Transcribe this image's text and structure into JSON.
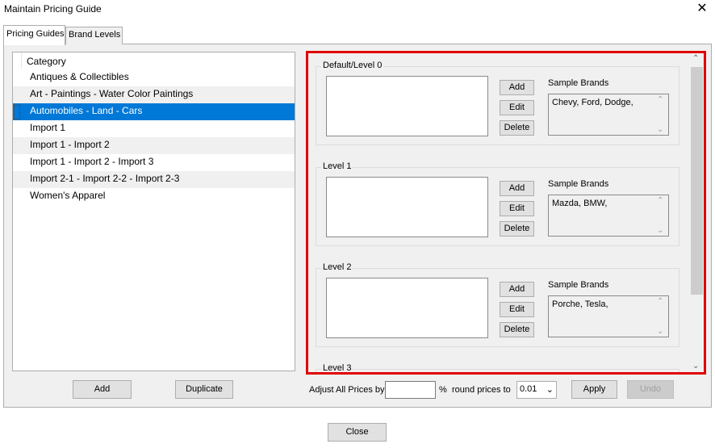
{
  "window": {
    "title": "Maintain Pricing Guide",
    "close_glyph": "✕"
  },
  "tabs": [
    {
      "label": "Pricing Guides",
      "active": true
    },
    {
      "label": "Brand Levels",
      "active": false
    }
  ],
  "category_list": {
    "header": "Category",
    "items": [
      "Antiques & Collectibles",
      "Art - Paintings - Water Color Paintings",
      "Automobiles - Land - Cars",
      "Import 1",
      "Import 1 - Import 2",
      "Import 1 - Import 2 - Import 3",
      "Import 2-1 - Import 2-2 - Import 2-3",
      "Women's Apparel"
    ],
    "selected_index": 2
  },
  "left_buttons": {
    "add": "Add",
    "duplicate": "Duplicate"
  },
  "levels": [
    {
      "label": "Default/Level 0",
      "add": "Add",
      "edit": "Edit",
      "delete": "Delete",
      "sample_label": "Sample Brands",
      "sample_brands": "Chevy, Ford, Dodge,"
    },
    {
      "label": "Level 1",
      "add": "Add",
      "edit": "Edit",
      "delete": "Delete",
      "sample_label": "Sample Brands",
      "sample_brands": "Mazda, BMW,"
    },
    {
      "label": "Level 2",
      "add": "Add",
      "edit": "Edit",
      "delete": "Delete",
      "sample_label": "Sample Brands",
      "sample_brands": "Porche, Tesla,"
    },
    {
      "label": "Level 3"
    }
  ],
  "adjust": {
    "label": "Adjust All Prices by",
    "percent_value": "",
    "percent_sign": "%",
    "round_label": "round prices to",
    "round_value": "0.01",
    "apply": "Apply",
    "undo": "Undo"
  },
  "footer": {
    "close": "Close"
  },
  "colors": {
    "selection": "#0078d7",
    "highlight_border": "#e00000",
    "panel_bg": "#f0f0f0"
  }
}
